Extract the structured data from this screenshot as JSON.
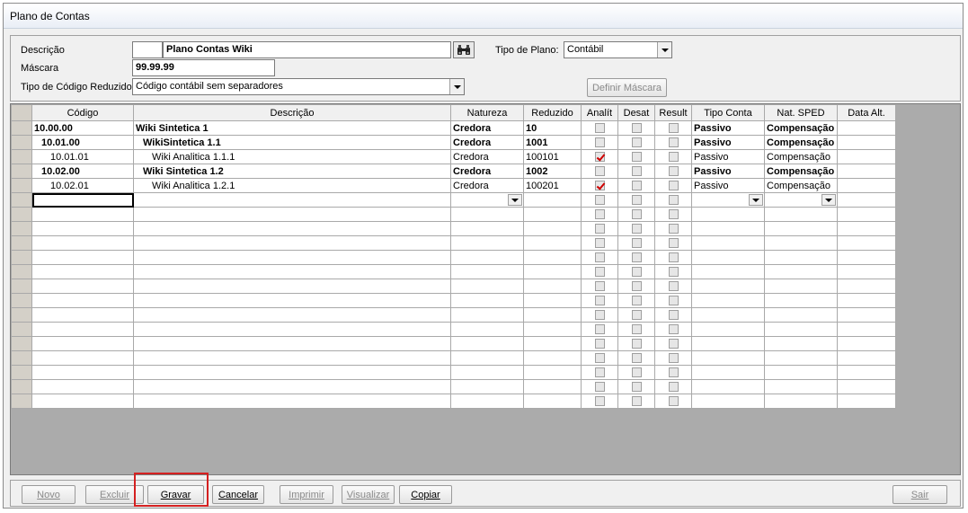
{
  "window": {
    "title": "Plano de Contas"
  },
  "header": {
    "descricao_label": "Descrição",
    "descricao_code": "",
    "descricao_value": "Plano Contas Wiki",
    "mascara_label": "Máscara",
    "mascara_value": "99.99.99",
    "tipo_codigo_label": "Tipo de Código Reduzido",
    "tipo_codigo_value": "Código contábil sem separadores",
    "tipo_plano_label": "Tipo de Plano:",
    "tipo_plano_value": "Contábil",
    "definir_mascara_label": "Definir Máscara"
  },
  "grid": {
    "columns": [
      "Código",
      "Descrição",
      "Natureza",
      "Reduzido",
      "Analít",
      "Desat",
      "Result",
      "Tipo Conta",
      "Nat. SPED",
      "Data Alt."
    ],
    "rows": [
      {
        "codigo": "10.00.00",
        "descricao": "Wiki Sintetica 1",
        "natureza": "Credora",
        "reduzido": "10",
        "analit": false,
        "desat": false,
        "result": false,
        "tipo": "Passivo",
        "sped": "Compensação",
        "data": "",
        "bold": true,
        "level": 1
      },
      {
        "codigo": "10.01.00",
        "descricao": "WikiSintetica 1.1",
        "natureza": "Credora",
        "reduzido": "1001",
        "analit": false,
        "desat": false,
        "result": false,
        "tipo": "Passivo",
        "sped": "Compensação",
        "data": "",
        "bold": true,
        "level": 2
      },
      {
        "codigo": "10.01.01",
        "descricao": "Wiki Analitica 1.1.1",
        "natureza": "Credora",
        "reduzido": "100101",
        "analit": true,
        "desat": false,
        "result": false,
        "tipo": "Passivo",
        "sped": "Compensação",
        "data": "",
        "bold": false,
        "level": 3
      },
      {
        "codigo": "10.02.00",
        "descricao": "Wiki Sintetica 1.2",
        "natureza": "Credora",
        "reduzido": "1002",
        "analit": false,
        "desat": false,
        "result": false,
        "tipo": "Passivo",
        "sped": "Compensação",
        "data": "",
        "bold": true,
        "level": 2
      },
      {
        "codigo": "10.02.01",
        "descricao": "Wiki Analitica 1.2.1",
        "natureza": "Credora",
        "reduzido": "100201",
        "analit": true,
        "desat": false,
        "result": false,
        "tipo": "Passivo",
        "sped": "Compensação",
        "data": "",
        "bold": false,
        "level": 3
      }
    ],
    "empty_rows": 15
  },
  "buttons": {
    "novo": "Novo",
    "excluir": "Excluir",
    "gravar": "Gravar",
    "cancelar": "Cancelar",
    "imprimir": "Imprimir",
    "visualizar": "Visualizar",
    "copiar": "Copiar",
    "sair": "Sair"
  },
  "icons": {
    "search": "binoculars-icon"
  },
  "colors": {
    "checkmark": "#d00000",
    "highlight": "#d42020"
  }
}
